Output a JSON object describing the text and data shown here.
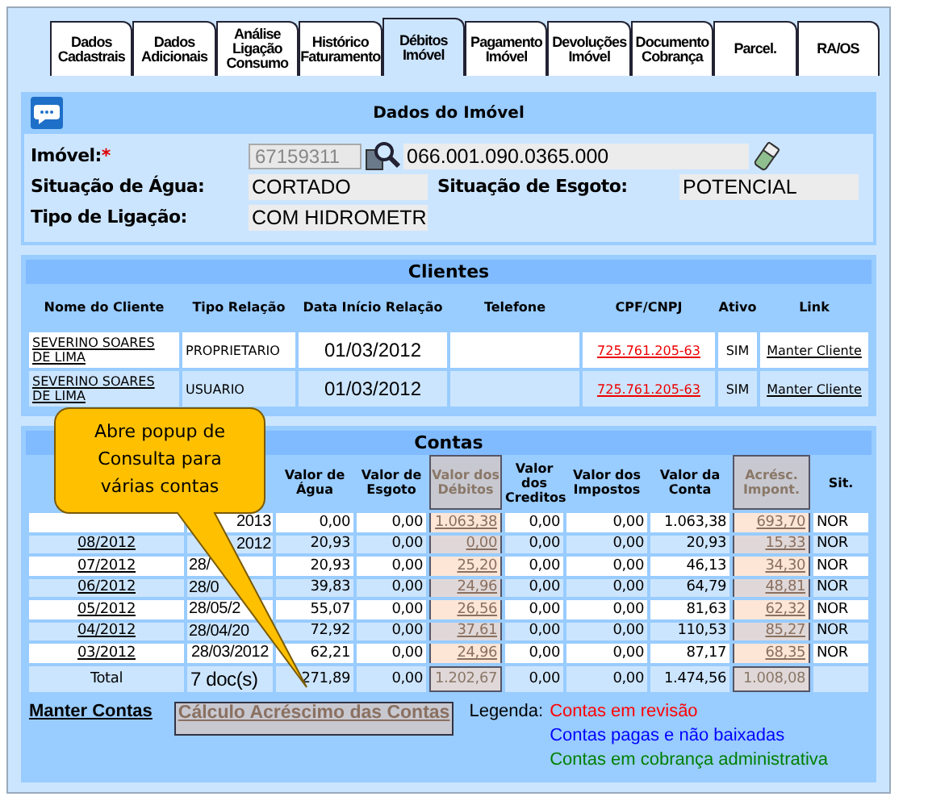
{
  "tabs": [
    {
      "label": "Dados\nCadastrais",
      "selected": false
    },
    {
      "label": "Dados\nAdicionais",
      "selected": false
    },
    {
      "label": "Análise\nLigação\nConsumo",
      "selected": false
    },
    {
      "label": "Histórico\nFaturamento",
      "selected": false
    },
    {
      "label": "Débitos\nImóvel",
      "selected": true
    },
    {
      "label": "Pagamento\nImóvel",
      "selected": false
    },
    {
      "label": "Devoluções\nImóvel",
      "selected": false
    },
    {
      "label": "Documento\nCobrança",
      "selected": false
    },
    {
      "label": "Parcel.",
      "selected": false
    },
    {
      "label": "RA/OS",
      "selected": false
    }
  ],
  "imovel": {
    "title": "Dados do Imóvel",
    "imovel_label": "Imóvel:",
    "required_mark": "*",
    "inscricao": "67159311",
    "matricula": "066.001.090.0365.000",
    "situacao_agua_label": "Situação de Água:",
    "situacao_agua": "CORTADO",
    "situacao_esgoto_label": "Situação de Esgoto:",
    "situacao_esgoto": "POTENCIAL",
    "tipo_ligacao_label": "Tipo de Ligação:",
    "tipo_ligacao": "COM HIDROMETR"
  },
  "clientes": {
    "title": "Clientes",
    "columns": [
      "Nome do Cliente",
      "Tipo Relação",
      "Data Início Relação",
      "Telefone",
      "CPF/CNPJ",
      "Ativo",
      "Link"
    ],
    "rows": [
      {
        "nome": "SEVERINO SOARES DE LIMA",
        "tipo": "PROPRIETARIO",
        "data": "01/03/2012",
        "cpf": "725.761.205-63",
        "ativo": "SIM",
        "link": "Manter Cliente"
      },
      {
        "nome": "SEVERINO SOARES DE LIMA",
        "tipo": "USUARIO",
        "data": "01/03/2012",
        "cpf": "725.761.205-63",
        "ativo": "SIM",
        "link": "Manter Cliente"
      }
    ]
  },
  "contas": {
    "title": "Contas",
    "columns": [
      {
        "label": "Valor de Água",
        "highlight": false
      },
      {
        "label": "Valor de Esgoto",
        "highlight": false
      },
      {
        "label": "Valor dos Débitos",
        "highlight": true
      },
      {
        "label": "Valor dos Creditos",
        "highlight": false
      },
      {
        "label": "Valor dos Impostos",
        "highlight": false
      },
      {
        "label": "Valor da Conta",
        "highlight": false
      },
      {
        "label": "Acrésc. Impont.",
        "highlight": true
      },
      {
        "label": "Sit.",
        "highlight": false
      }
    ],
    "rows": [
      {
        "vencimento": "2013",
        "cut_left": true,
        "cut_right": false,
        "values": [
          "0,00",
          "0,00",
          "1.063,38",
          "0,00",
          "0,00",
          "1.063,38",
          "693,70",
          "NOR"
        ]
      },
      {
        "mes": "08/2012",
        "vencimento": "2012",
        "cut_left": true,
        "cut_right": false,
        "values": [
          "20,93",
          "0,00",
          "0,00",
          "0,00",
          "0,00",
          "20,93",
          "15,33",
          "NOR"
        ]
      },
      {
        "mes": "07/2012",
        "vencimento": "28/",
        "cut_left": false,
        "cut_right": true,
        "values": [
          "20,93",
          "0,00",
          "25,20",
          "0,00",
          "0,00",
          "46,13",
          "34,30",
          "NOR"
        ]
      },
      {
        "mes": "06/2012",
        "vencimento": "28/0",
        "cut_left": false,
        "cut_right": true,
        "values": [
          "39,83",
          "0,00",
          "24,96",
          "0,00",
          "0,00",
          "64,79",
          "48,81",
          "NOR"
        ]
      },
      {
        "mes": "05/2012",
        "vencimento": "28/05/2",
        "cut_left": false,
        "cut_right": true,
        "values": [
          "55,07",
          "0,00",
          "26,56",
          "0,00",
          "0,00",
          "81,63",
          "62,32",
          "NOR"
        ]
      },
      {
        "mes": "04/2012",
        "vencimento": "28/04/20",
        "cut_left": false,
        "cut_right": true,
        "values": [
          "72,92",
          "0,00",
          "37,61",
          "0,00",
          "0,00",
          "110,53",
          "85,27",
          "NOR"
        ]
      },
      {
        "mes": "03/2012",
        "vencimento": "28/03/2012",
        "cut_left": false,
        "cut_right": false,
        "values": [
          "62,21",
          "0,00",
          "24,96",
          "0,00",
          "0,00",
          "87,17",
          "68,35",
          "NOR"
        ]
      }
    ],
    "total_label": "Total",
    "total_docs": "7  doc(s)",
    "totals": [
      "271,89",
      "0,00",
      "1.202,67",
      "0,00",
      "0,00",
      "1.474,56",
      "1.008,08"
    ],
    "manter_link": "Manter Contas",
    "calculo_button": "Cálculo Acréscimo das Contas",
    "legend_label": "Legenda:",
    "legend": [
      {
        "text": "Contas em revisão",
        "color": "#ff0000"
      },
      {
        "text": "Contas pagas e não baixadas",
        "color": "#0000ff"
      },
      {
        "text": "Contas em cobrança administrativa",
        "color": "#008000"
      }
    ]
  },
  "callout": "Abre popup de Consulta para várias contas"
}
